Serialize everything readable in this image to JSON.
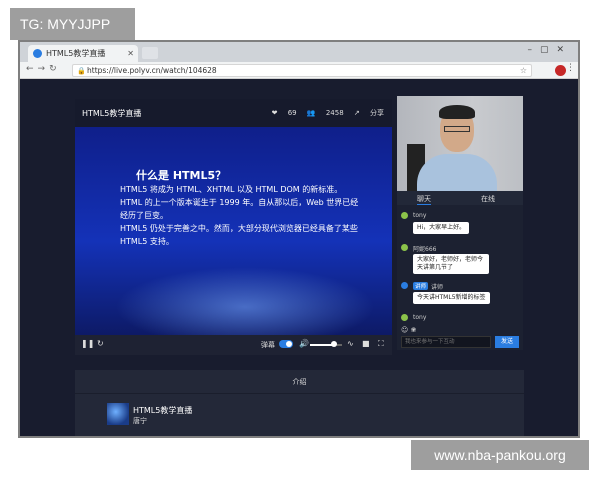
{
  "badges": {
    "tg": "TG: MYYJJPP",
    "watermark": "www.nba-pankou.org"
  },
  "browser": {
    "tab_title": "HTML5教学直播",
    "url": "https://live.polyv.cn/watch/104628"
  },
  "player": {
    "title": "HTML5教学直播",
    "likes": "69",
    "viewers": "2458",
    "share": "分享",
    "slide": {
      "title": "什么是 HTML5？",
      "lines": [
        "HTML5 将成为 HTML、XHTML 以及 HTML DOM 的新标准。",
        "HTML 的上一个版本诞生于 1999 年。自从那以后，Web 世界已经经历了巨变。",
        "HTML5 仍处于完善之中。然而，大部分现代浏览器已经具备了某些 HTML5 支持。"
      ]
    },
    "controls": {
      "danmu": "弹幕",
      "volume": 0.75
    }
  },
  "side": {
    "tabs": [
      "聊天",
      "在线"
    ],
    "messages": [
      {
        "name": "tony",
        "text": "Hi，大家早上好。"
      },
      {
        "name": "阿妮666",
        "text": "大家好，老师好，老师今天讲第几节了"
      },
      {
        "badge": "讲师",
        "name": "讲师",
        "text": "今天讲HTML5新增的标签"
      },
      {
        "name": "tony",
        "text": ""
      }
    ],
    "input_placeholder": "我也来参与一下互动",
    "send": "发送"
  },
  "intro": {
    "tab": "介绍",
    "title": "HTML5教学直播",
    "author": "唐宁"
  }
}
